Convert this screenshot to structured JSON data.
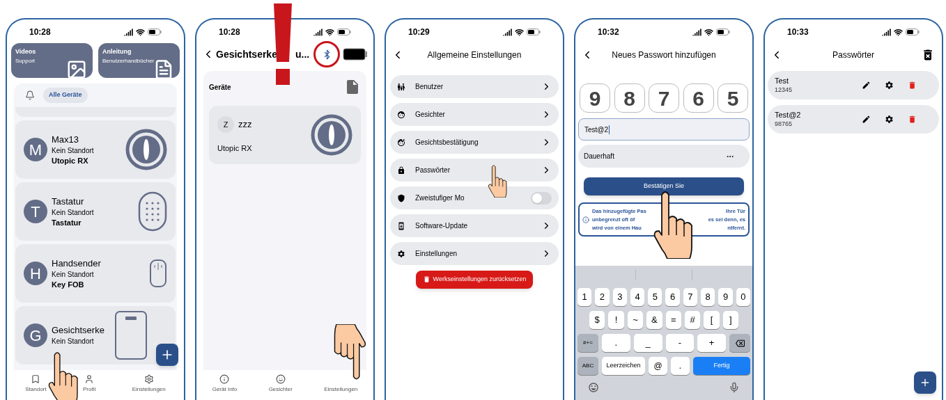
{
  "devices_screen": {
    "time": "10:28",
    "tiles": [
      {
        "title": "Videos",
        "subtitle": "Support",
        "kind": "video"
      },
      {
        "title": "Anleitung",
        "subtitle": "Benutzerhandbücher",
        "kind": "manual"
      }
    ],
    "filter_chip": "Alle Geräte",
    "devices": [
      {
        "initial": "M",
        "name": "Max13",
        "location": "Kein Standort",
        "model": "Utopic RX",
        "kind": "lock"
      },
      {
        "initial": "T",
        "name": "Tastatur",
        "location": "Kein Standort",
        "model": "Tastatur",
        "kind": "keypad"
      },
      {
        "initial": "H",
        "name": "Handsender",
        "location": "Kein Standort",
        "model": "Key FOB",
        "kind": "fob"
      },
      {
        "initial": "G",
        "name": "Gesichtserke",
        "location": "Kein Standort",
        "kind": "face_terminal"
      }
    ],
    "nav": [
      {
        "label": "Standort",
        "kind": "bookmark"
      },
      {
        "label": "Profil",
        "kind": "person"
      },
      {
        "label": "Einstellungen",
        "kind": "gear"
      }
    ]
  },
  "device_screen": {
    "time": "10:28",
    "title": "Gesichtserke",
    "title_tail": "u...",
    "section": "Geräte",
    "device": {
      "initial": "Z",
      "name": "zzz",
      "model": "Utopic RX",
      "kind": "lock"
    },
    "nav": [
      {
        "label": "Gerät Info",
        "kind": "info"
      },
      {
        "label": "Gesichter",
        "kind": "face"
      },
      {
        "label": "Einstellungen",
        "kind": "covered"
      }
    ]
  },
  "settings_screen": {
    "time": "10:29",
    "title": "Allgemeine Einstellungen",
    "items": [
      {
        "label": "Benutzer",
        "kind": "link"
      },
      {
        "label": "Gesichter",
        "kind": "link"
      },
      {
        "label": "Gesichtsbestätigung",
        "kind": "link"
      },
      {
        "label": "Passwörter",
        "kind": "link"
      },
      {
        "label": "Zweistufiger Mo",
        "kind": "toggle",
        "on": false
      },
      {
        "label": "Software-Update",
        "kind": "link"
      },
      {
        "label": "Einstellungen",
        "kind": "link"
      }
    ],
    "reset_button": "Werkseinstellungen zurücksetzen"
  },
  "new_password_screen": {
    "time": "10:32",
    "title": "Neues Passwort hinzufügen",
    "digits": [
      "9",
      "8",
      "7",
      "6",
      "5"
    ],
    "name_field": {
      "value": "Test@2"
    },
    "duration_field": {
      "value": "Dauerhaft"
    },
    "confirm_button": "Bestätigen Sie",
    "info_lines": [
      {
        "left": "Das hinzugefügte Pas",
        "right": "Ihre Tür"
      },
      {
        "left": "unbegrenzt oft öf",
        "right": "es sei denn, es"
      },
      {
        "left": "wird von einem Hau",
        "right": "ntfernt."
      }
    ],
    "keyboard": [
      [
        {
          "label": "1",
          "kind": "char"
        },
        {
          "label": "2",
          "kind": "char"
        },
        {
          "label": "3",
          "kind": "char"
        },
        {
          "label": "4",
          "kind": "char"
        },
        {
          "label": "5",
          "kind": "char"
        },
        {
          "label": "6",
          "kind": "char"
        },
        {
          "label": "7",
          "kind": "char"
        },
        {
          "label": "8",
          "kind": "char"
        },
        {
          "label": "9",
          "kind": "char"
        },
        {
          "label": "0",
          "kind": "char"
        }
      ],
      [
        {
          "label": "$",
          "kind": "char"
        },
        {
          "label": "!",
          "kind": "char"
        },
        {
          "label": "~",
          "kind": "char"
        },
        {
          "label": "&",
          "kind": "char"
        },
        {
          "label": "=",
          "kind": "char"
        },
        {
          "label": "#",
          "kind": "char"
        },
        {
          "label": "[",
          "kind": "char"
        },
        {
          "label": "]",
          "kind": "char"
        }
      ],
      [
        {
          "label": "#+=",
          "kind": "function"
        },
        {
          "label": ".",
          "kind": "char"
        },
        {
          "label": "_",
          "kind": "char"
        },
        {
          "label": "-",
          "kind": "char"
        },
        {
          "label": "+",
          "kind": "char"
        },
        {
          "kind": "backspace"
        }
      ],
      [
        {
          "label": "ABC",
          "kind": "function"
        },
        {
          "label": "Leerzeichen",
          "kind": "space"
        },
        {
          "label": "@",
          "kind": "small"
        },
        {
          "label": ".",
          "kind": "small"
        },
        {
          "label": "Fertig",
          "kind": "done"
        }
      ]
    ]
  },
  "passwords_screen": {
    "time": "10:33",
    "title": "Passwörter",
    "entries": [
      {
        "name": "Test",
        "code": "12345"
      },
      {
        "name": "Test@2",
        "code": "98765"
      }
    ]
  }
}
